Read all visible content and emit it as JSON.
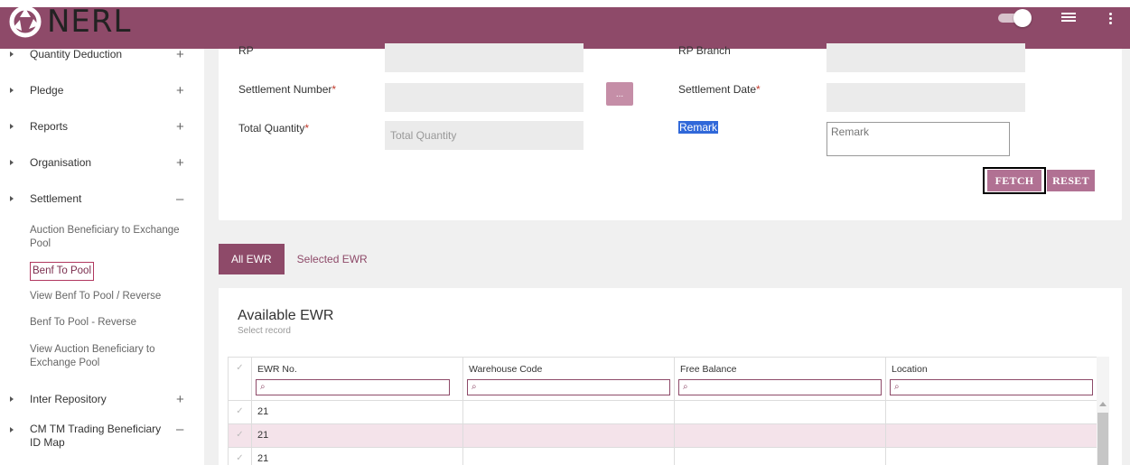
{
  "brand": {
    "name": "NERL"
  },
  "topbar": {
    "toggle_on": true,
    "list_icon": "list-icon",
    "more_icon": "more-vertical-icon"
  },
  "sidebar": {
    "items": [
      {
        "label": "Quantity Deduction",
        "sign": "+"
      },
      {
        "label": "Pledge",
        "sign": "+"
      },
      {
        "label": "Reports",
        "sign": "+"
      },
      {
        "label": "Organisation",
        "sign": "+"
      },
      {
        "label": "Settlement",
        "sign": "–"
      },
      {
        "label": "Inter Repository",
        "sign": "+"
      },
      {
        "label": "CM TM Trading Beneficiary ID Map",
        "sign": "–"
      }
    ],
    "settlement_subitems": [
      "Auction Beneficiary to Exchange Pool",
      "Benf To Pool",
      "View Benf To Pool / Reverse",
      "Benf To Pool - Reverse",
      "View Auction Beneficiary to Exchange Pool"
    ]
  },
  "form": {
    "rp_label": "RP",
    "rp_branch_label": "RP Branch",
    "settlement_number_label": "Settlement Number",
    "settlement_date_label": "Settlement Date",
    "total_quantity_label": "Total Quantity",
    "total_quantity_placeholder": "Total Quantity",
    "remark_label": "Remark",
    "remark_placeholder": "Remark",
    "required_mark": "*",
    "lookup_button": "...",
    "fetch_button": "FETCH",
    "reset_button": "RESET"
  },
  "tabs": [
    {
      "label": "All EWR",
      "active": true
    },
    {
      "label": "Selected EWR",
      "active": false
    }
  ],
  "grid": {
    "title": "Available EWR",
    "subtitle": "Select record",
    "columns": [
      "EWR No.",
      "Warehouse Code",
      "Free Balance",
      "Location"
    ],
    "filter_icon": "search-icon",
    "rows": [
      {
        "ewr_no": "21"
      },
      {
        "ewr_no": "21"
      },
      {
        "ewr_no": "21"
      }
    ]
  },
  "colors": {
    "brand": "#8e4a69",
    "button": "#b17193",
    "required": "#c0392b"
  }
}
